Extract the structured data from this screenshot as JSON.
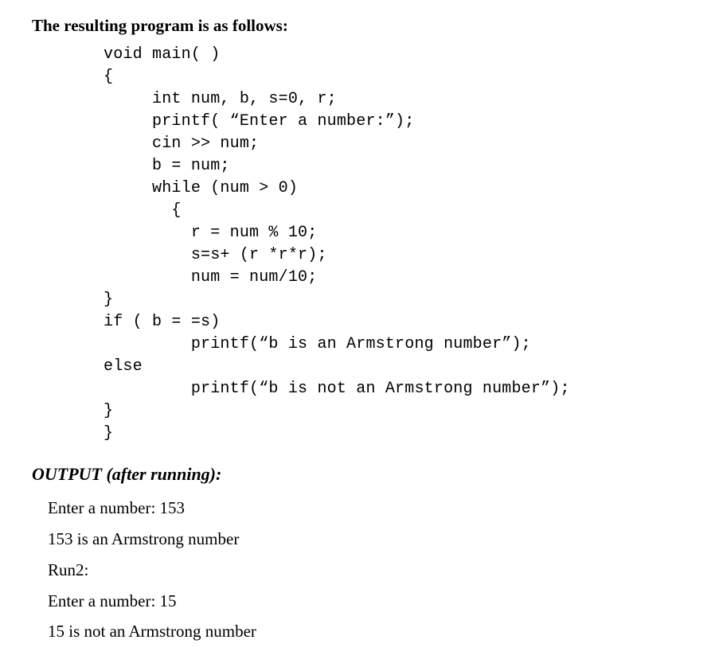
{
  "heading": "The resulting program is as follows:",
  "code": "void main( )\n{\n     int num, b, s=0, r;\n     printf( “Enter a number:”);\n     cin >> num;\n     b = num;\n     while (num > 0)\n       {\n         r = num % 10;\n         s=s+ (r *r*r);\n         num = num/10;\n}\nif ( b = =s)\n         printf(“b is an Armstrong number”);\nelse\n         printf(“b is not an Armstrong number”);\n}\n}",
  "output_heading": "OUTPUT (after running):",
  "output_lines": [
    "Enter a number: 153",
    "153 is an Armstrong number",
    "Run2:",
    "Enter a number: 15",
    "15 is not an Armstrong number"
  ]
}
